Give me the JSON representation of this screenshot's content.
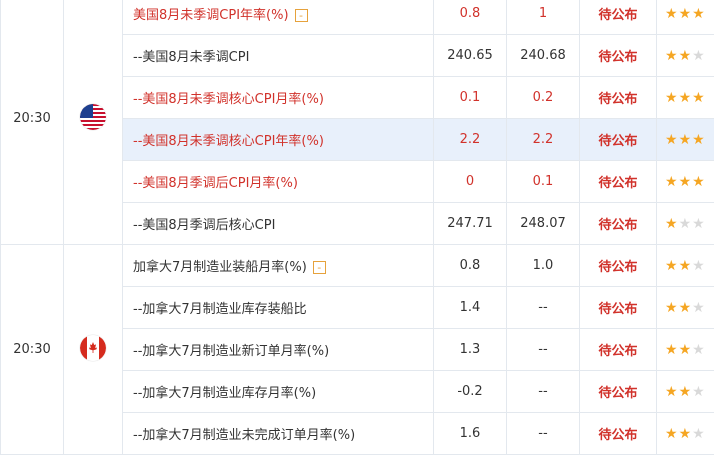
{
  "colors": {
    "red_text": "#d1322b",
    "status": "#d1322b",
    "star_on": "#f5a623",
    "star_off": "#d9d9d9",
    "highlight_row": "#e8f0fb",
    "expand_box": "#e6a23c"
  },
  "groups": [
    {
      "time": "20:30",
      "flag_icon": "us-flag-icon",
      "rows": [
        {
          "name": "美国8月未季调CPI年率(%)",
          "prev": "0.8",
          "forecast": "1",
          "status": "待公布",
          "stars": 3,
          "red": true,
          "expand": "-"
        },
        {
          "name": "--美国8月未季调CPI",
          "prev": "240.65",
          "forecast": "240.68",
          "status": "待公布",
          "stars": 2,
          "red": false
        },
        {
          "name": "--美国8月未季调核心CPI月率(%)",
          "prev": "0.1",
          "forecast": "0.2",
          "status": "待公布",
          "stars": 3,
          "red": true
        },
        {
          "name": "--美国8月未季调核心CPI年率(%)",
          "prev": "2.2",
          "forecast": "2.2",
          "status": "待公布",
          "stars": 3,
          "red": true,
          "highlight": true
        },
        {
          "name": "--美国8月季调后CPI月率(%)",
          "prev": "0",
          "forecast": "0.1",
          "status": "待公布",
          "stars": 3,
          "red": true
        },
        {
          "name": "--美国8月季调后核心CPI",
          "prev": "247.71",
          "forecast": "248.07",
          "status": "待公布",
          "stars": 1,
          "red": false
        }
      ]
    },
    {
      "time": "20:30",
      "flag_icon": "canada-flag-icon",
      "rows": [
        {
          "name": "加拿大7月制造业装船月率(%)",
          "prev": "0.8",
          "forecast": "1.0",
          "status": "待公布",
          "stars": 2,
          "red": false,
          "expand": "-"
        },
        {
          "name": "--加拿大7月制造业库存装船比",
          "prev": "1.4",
          "forecast": "--",
          "status": "待公布",
          "stars": 2,
          "red": false
        },
        {
          "name": "--加拿大7月制造业新订单月率(%)",
          "prev": "1.3",
          "forecast": "--",
          "status": "待公布",
          "stars": 2,
          "red": false
        },
        {
          "name": "--加拿大7月制造业库存月率(%)",
          "prev": "-0.2",
          "forecast": "--",
          "status": "待公布",
          "stars": 2,
          "red": false
        },
        {
          "name": "--加拿大7月制造业未完成订单月率(%)",
          "prev": "1.6",
          "forecast": "--",
          "status": "待公布",
          "stars": 2,
          "red": false
        }
      ]
    }
  ]
}
